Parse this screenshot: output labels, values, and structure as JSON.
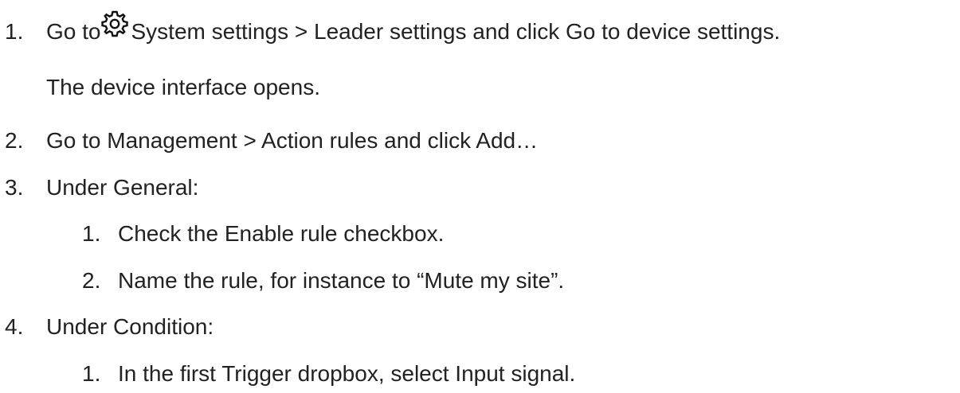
{
  "steps": [
    {
      "number": "1.",
      "prefix": "Go to",
      "icon": "gear-icon",
      "text": "System settings > Leader settings and click Go to device settings.",
      "continuation": "The device interface opens."
    },
    {
      "number": "2.",
      "text": "Go to Management > Action rules and click Add…"
    },
    {
      "number": "3.",
      "text": "Under General:",
      "substeps": [
        {
          "number": "1.",
          "text": "Check the Enable rule checkbox."
        },
        {
          "number": "2.",
          "text": "Name the rule, for instance to “Mute my site”."
        }
      ]
    },
    {
      "number": "4.",
      "text": "Under Condition:",
      "substeps": [
        {
          "number": "1.",
          "text": "In the first Trigger dropbox, select Input signal."
        }
      ]
    }
  ]
}
